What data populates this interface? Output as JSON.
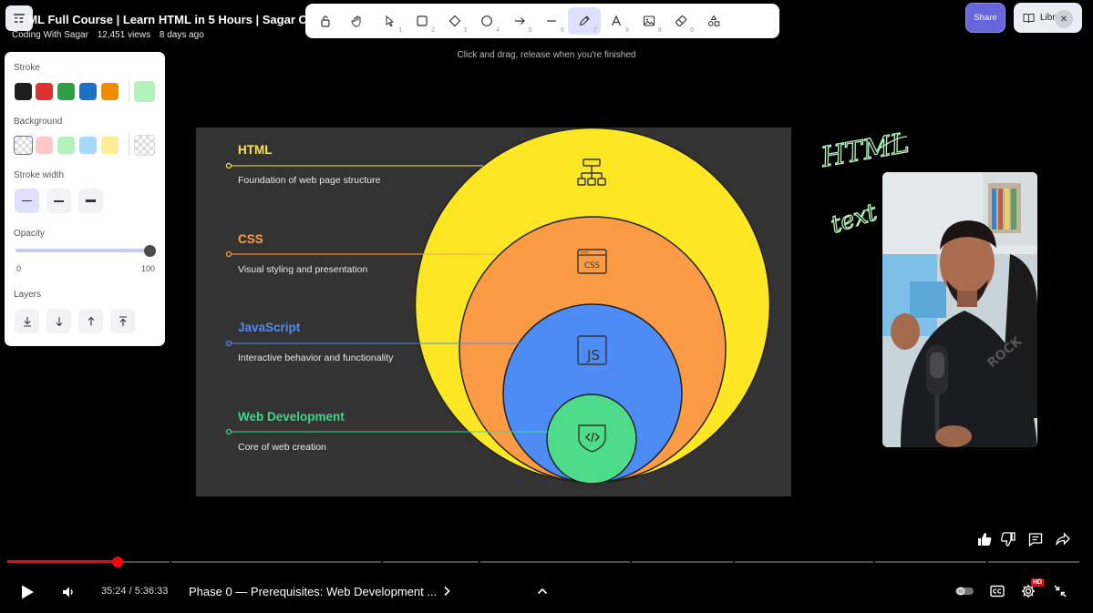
{
  "video": {
    "title": "HTML Full Course | Learn HTML in 5 Hours | Sagar Chouksey",
    "channel": "Coding With Sagar",
    "views": "12,451 views",
    "age": "8 days ago"
  },
  "toolbar": {
    "tools": [
      {
        "name": "lock-tool",
        "key": ""
      },
      {
        "name": "hand-tool",
        "key": ""
      },
      {
        "name": "select-tool",
        "key": "1"
      },
      {
        "name": "rectangle-tool",
        "key": "2"
      },
      {
        "name": "diamond-tool",
        "key": "3"
      },
      {
        "name": "ellipse-tool",
        "key": "4"
      },
      {
        "name": "arrow-tool",
        "key": "5"
      },
      {
        "name": "line-tool",
        "key": "6"
      },
      {
        "name": "pencil-tool",
        "key": "7"
      },
      {
        "name": "text-tool",
        "key": "8"
      },
      {
        "name": "image-tool",
        "key": "9"
      },
      {
        "name": "eraser-tool",
        "key": "0"
      },
      {
        "name": "more-tools",
        "key": ""
      }
    ],
    "hint": "Click and drag, release when you're finished",
    "active_color": "#e0dfff"
  },
  "share_label": "Share",
  "library_label": "Library",
  "panel": {
    "stroke_label": "Stroke",
    "stroke_colors": [
      "#1e1e1e",
      "#e03131",
      "#2f9e44",
      "#1971c2",
      "#f08c00"
    ],
    "stroke_current": "#b2f2bb",
    "background_label": "Background",
    "background_colors": [
      "transparent",
      "#ffc9c9",
      "#b2f2bb",
      "#a5d8ff",
      "#ffec99"
    ],
    "stroke_width_label": "Stroke width",
    "opacity_label": "Opacity",
    "opacity_min": "0",
    "opacity_max": "100",
    "opacity_value": 100,
    "layers_label": "Layers"
  },
  "slide": {
    "rows": [
      {
        "title": "HTML",
        "desc": "Foundation of web page structure",
        "color": "#f7e35a"
      },
      {
        "title": "CSS",
        "desc": "Visual styling and presentation",
        "color": "#f7a049"
      },
      {
        "title": "JavaScript",
        "desc": "Interactive behavior and functionality",
        "color": "#4d8cf5"
      },
      {
        "title": "Web Development",
        "desc": "Core of web creation",
        "color": "#3fd68a"
      }
    ],
    "circle_colors": [
      "#fde725",
      "#fb9b45",
      "#4d8cf5",
      "#4fdc8a"
    ],
    "css_icon_text": "CSS",
    "js_icon_text": "JS"
  },
  "handwriting": [
    "HTML",
    "text"
  ],
  "player": {
    "current_time": "35:24",
    "separator": " / ",
    "duration": "5:36:33",
    "progress_fraction": 0.105,
    "chapter": "Phase 0 — Prerequisites: Web Development ...",
    "hd_badge": "HD"
  }
}
